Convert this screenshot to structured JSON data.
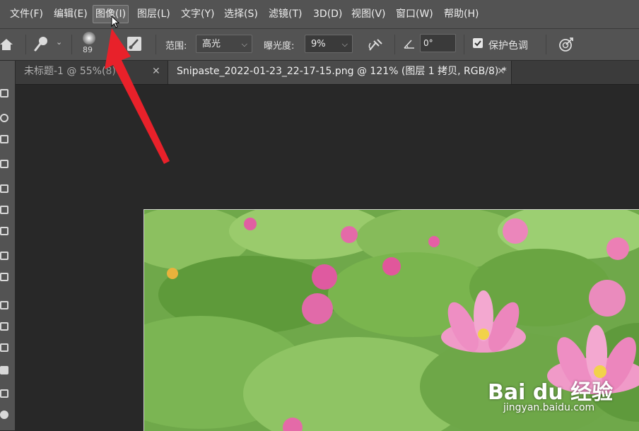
{
  "menu": {
    "items": [
      "文件(F)",
      "编辑(E)",
      "图像(I)",
      "图层(L)",
      "文字(Y)",
      "选择(S)",
      "滤镜(T)",
      "3D(D)",
      "视图(V)",
      "窗口(W)",
      "帮助(H)"
    ]
  },
  "options": {
    "brush_size": "89",
    "range_label": "范围:",
    "range_value": "高光",
    "exposure_label": "曝光度:",
    "exposure_value": "9%",
    "angle_value": "0°",
    "protect_tones_label": "保护色调",
    "protect_tones_checked": true
  },
  "tabs": [
    {
      "label": "未标题-1 @ 55%(",
      "label_tail": "8) *",
      "active": false
    },
    {
      "label": "Snipaste_2022-01-23_22-17-15.png @ 121% (图层 1 拷贝, RGB/8) *",
      "active": true
    }
  ],
  "watermark": {
    "brand": "Bai du 经验",
    "url": "jingyan.baidu.com"
  },
  "colors": {
    "annotation_arrow": "#e8212a",
    "ui_bg": "#535353",
    "canvas_bg": "#282828"
  }
}
